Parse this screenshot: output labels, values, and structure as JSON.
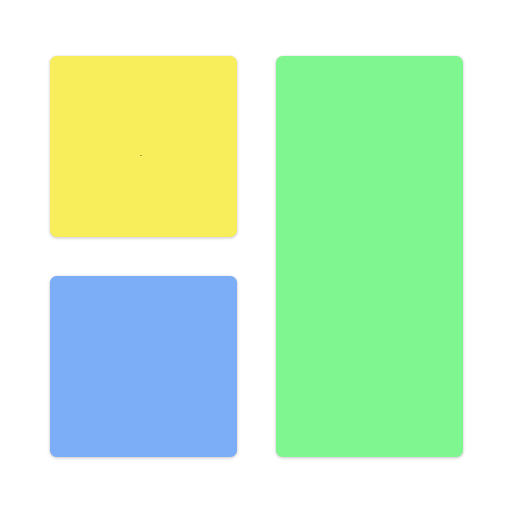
{
  "tiles": [
    {
      "id": "yellow",
      "color": "#F8ED5A"
    },
    {
      "id": "blue",
      "color": "#7BAEF6"
    },
    {
      "id": "green",
      "color": "#7FF68F"
    }
  ]
}
